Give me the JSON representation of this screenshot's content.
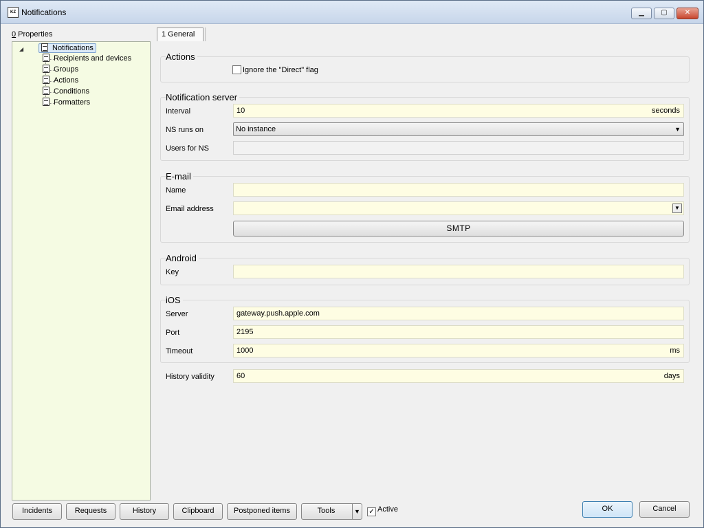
{
  "window": {
    "title": "Notifications",
    "icon_text": "KZ",
    "controls": {
      "minimize": "▁",
      "maximize": "▢",
      "close": "✕"
    }
  },
  "left_panel": {
    "properties_label_underline": "0",
    "properties_label_rest": " Properties",
    "tree": {
      "root": "Notifications",
      "children": [
        "Recipients and devices",
        "Groups",
        "Actions",
        "Conditions",
        "Formatters"
      ]
    }
  },
  "tabs": [
    {
      "label": "1 General"
    }
  ],
  "actions": {
    "title": "Actions",
    "ignore_direct_label": "Ignore the \"Direct\" flag",
    "ignore_direct_checked": false
  },
  "notification_server": {
    "title": "Notification server",
    "interval_label": "Interval",
    "interval_value": "10",
    "interval_unit": "seconds",
    "ns_runs_on_label": "NS runs on",
    "ns_runs_on_value": "No instance",
    "users_for_ns_label": "Users for NS",
    "users_for_ns_value": ""
  },
  "email": {
    "title": "E-mail",
    "name_label": "Name",
    "name_value": "",
    "address_label": "Email address",
    "address_value": "",
    "smtp_button": "SMTP"
  },
  "android": {
    "title": "Android",
    "key_label": "Key",
    "key_value": ""
  },
  "ios": {
    "title": "iOS",
    "server_label": "Server",
    "server_value": "gateway.push.apple.com",
    "port_label": "Port",
    "port_value": "2195",
    "timeout_label": "Timeout",
    "timeout_value": "1000",
    "timeout_unit": "ms"
  },
  "history": {
    "label": "History validity",
    "value": "60",
    "unit": "days"
  },
  "bottom_bar": {
    "buttons": [
      "Incidents",
      "Requests",
      "History",
      "Clipboard",
      "Postponed items",
      "Tools"
    ],
    "active_label": "Active",
    "active_checked": true,
    "ok": "OK",
    "cancel": "Cancel"
  },
  "colors": {
    "input_background": "#fefde3",
    "tree_background": "#f5fbe3",
    "window_background": "#f0f0f0"
  }
}
